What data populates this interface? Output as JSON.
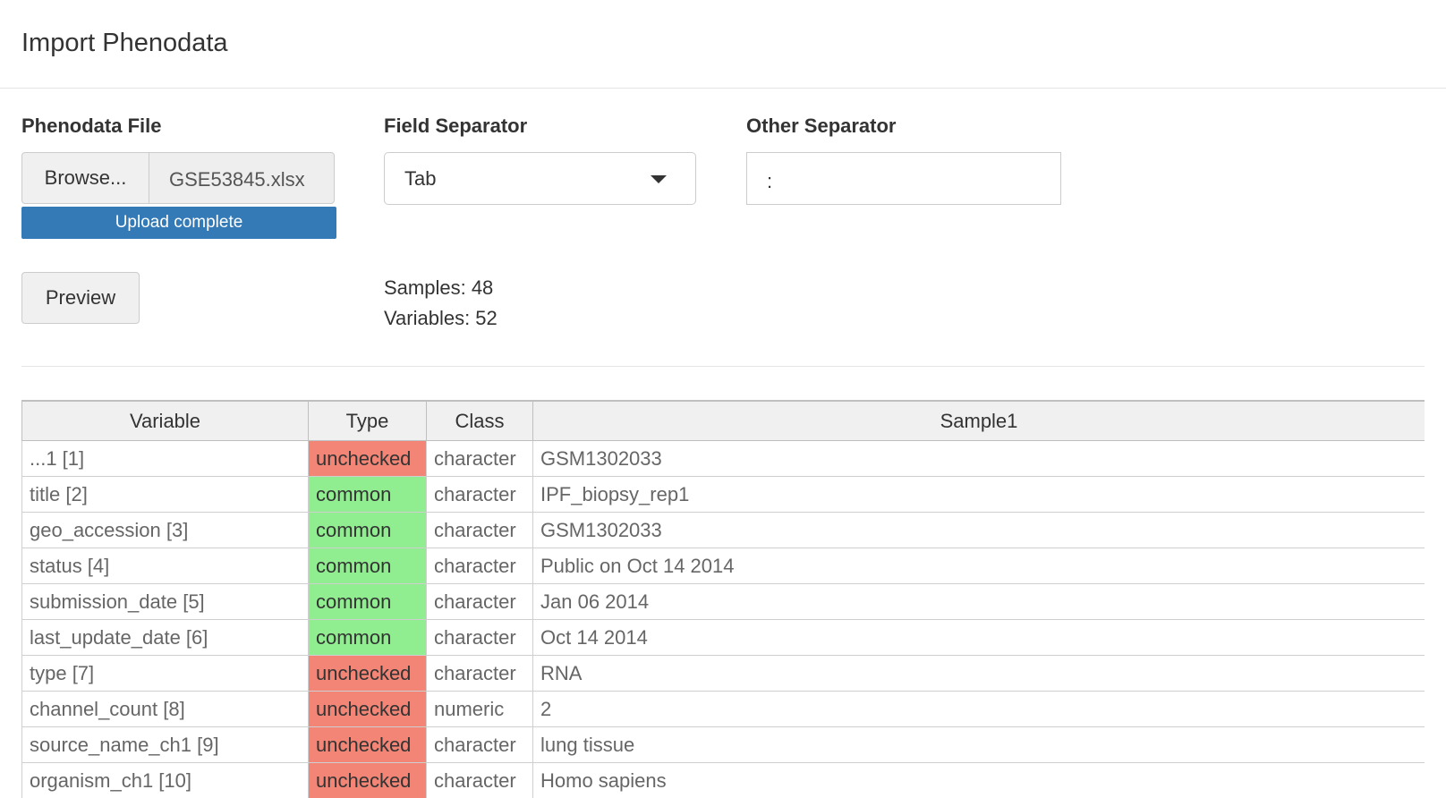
{
  "modal": {
    "title": "Import Phenodata"
  },
  "form": {
    "phenodata_file_label": "Phenodata File",
    "browse_label": "Browse...",
    "file_name": "GSE53845.xlsx",
    "upload_status": "Upload complete",
    "upload_progress_percent": 100,
    "field_separator_label": "Field Separator",
    "field_separator_value": "Tab",
    "other_separator_label": "Other Separator",
    "other_separator_value": ":",
    "preview_label": "Preview"
  },
  "summary": {
    "samples": "Samples: 48",
    "variables": "Variables: 52"
  },
  "table": {
    "headers": [
      "Variable",
      "Type",
      "Class",
      "Sample1"
    ],
    "rows": [
      {
        "variable": "...1 [1]",
        "type": "unchecked",
        "class": "character",
        "sample1": "GSM1302033"
      },
      {
        "variable": "title [2]",
        "type": "common",
        "class": "character",
        "sample1": "IPF_biopsy_rep1"
      },
      {
        "variable": "geo_accession [3]",
        "type": "common",
        "class": "character",
        "sample1": "GSM1302033"
      },
      {
        "variable": "status [4]",
        "type": "common",
        "class": "character",
        "sample1": "Public on Oct 14 2014"
      },
      {
        "variable": "submission_date [5]",
        "type": "common",
        "class": "character",
        "sample1": "Jan 06 2014"
      },
      {
        "variable": "last_update_date [6]",
        "type": "common",
        "class": "character",
        "sample1": "Oct 14 2014"
      },
      {
        "variable": "type [7]",
        "type": "unchecked",
        "class": "character",
        "sample1": "RNA"
      },
      {
        "variable": "channel_count [8]",
        "type": "unchecked",
        "class": "numeric",
        "sample1": "2"
      },
      {
        "variable": "source_name_ch1 [9]",
        "type": "unchecked",
        "class": "character",
        "sample1": "lung tissue"
      },
      {
        "variable": "organism_ch1 [10]",
        "type": "unchecked",
        "class": "character",
        "sample1": "Homo sapiens"
      }
    ]
  },
  "colors": {
    "unchecked": "#f28575",
    "common": "#90ee90",
    "progress": "#337ab7"
  }
}
